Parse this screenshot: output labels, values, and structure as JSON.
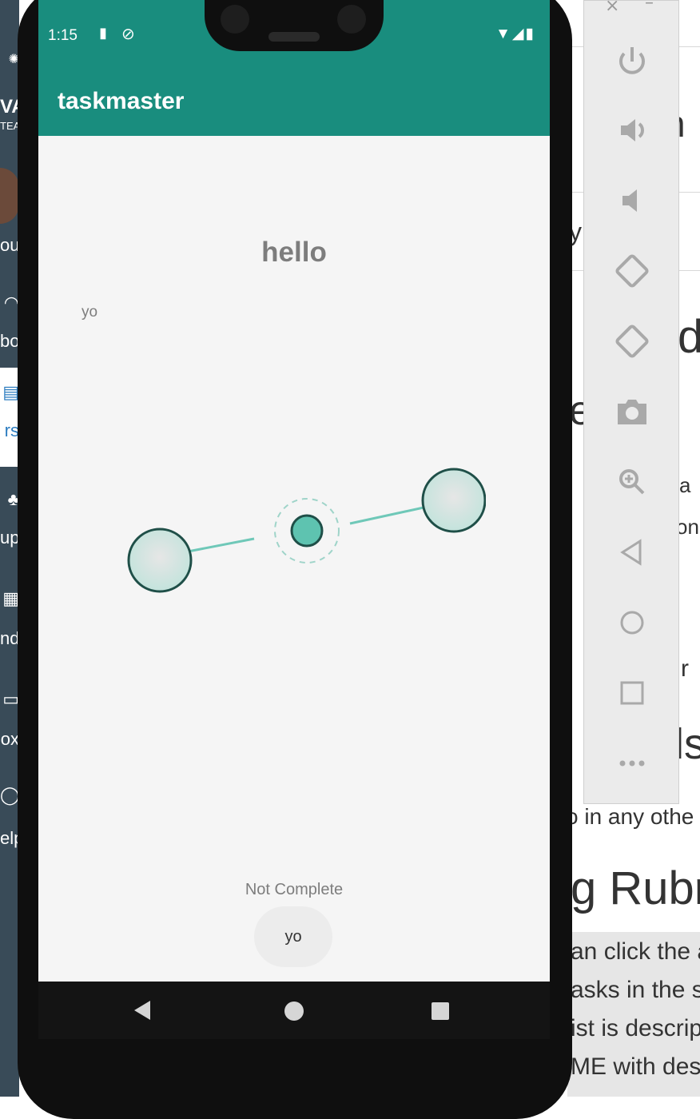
{
  "app": {
    "title": "taskmaster",
    "accent_color": "#198d7e"
  },
  "status_bar": {
    "time": "1:15",
    "left_icons": [
      "sd-card-icon",
      "sync-icon"
    ],
    "right_icons": [
      "wifi-icon",
      "signal-icon",
      "battery-icon"
    ]
  },
  "task": {
    "title": "hello",
    "body": "yo",
    "state": "Not Complete",
    "button_label": "yo"
  },
  "nav_bar": {
    "buttons": [
      "back-icon",
      "home-icon",
      "recents-icon"
    ]
  },
  "emulator_toolbar": {
    "window_controls": [
      "×",
      "–"
    ],
    "buttons": [
      "power-icon",
      "volume-up-icon",
      "volume-down-icon",
      "rotate-left-icon",
      "rotate-right-icon",
      "camera-icon",
      "zoom-icon",
      "back-icon",
      "home-icon",
      "overview-icon",
      "more-icon"
    ]
  },
  "background_page": {
    "fragments": [
      "n",
      "y",
      "d",
      "e",
      "a",
      "on",
      "r",
      "ls",
      "o in any othe",
      "g Rubr",
      "an click the a",
      "asks in the se",
      "ist is descrip",
      "ME with des"
    ]
  },
  "lms_sidebar": {
    "fragments": [
      "VA",
      "TEAC",
      "ou",
      "bo",
      "rs",
      "up",
      "nd",
      "ox",
      "elp"
    ]
  }
}
